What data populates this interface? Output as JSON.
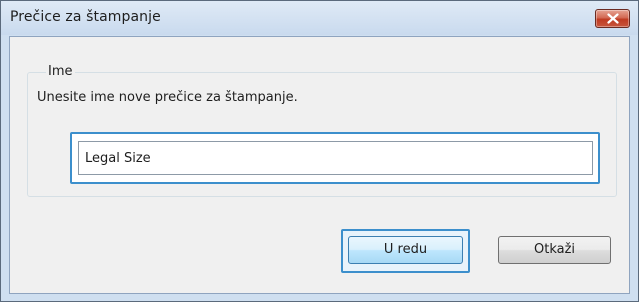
{
  "dialog": {
    "title": "Prečice za štampanje",
    "close_label": "close"
  },
  "name_group": {
    "legend": "Ime",
    "instruction": "Unesite ime nove prečice za štampanje.",
    "input_value": "Legal Size"
  },
  "buttons": {
    "ok_label": "U redu",
    "cancel_label": "Otkaži"
  },
  "colors": {
    "title_bar": "#cfdff0",
    "close_button": "#c8563d",
    "focus_ring": "#3c8fcc",
    "client_bg": "#f0f0f0"
  },
  "icons": {
    "close": "close-icon"
  }
}
